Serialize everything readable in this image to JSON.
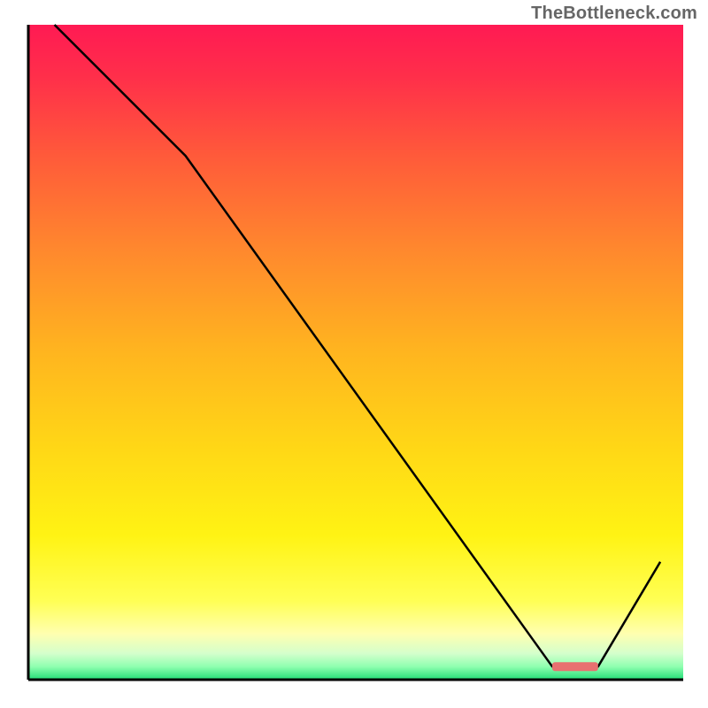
{
  "watermark": "TheBottleneck.com",
  "chart_data": {
    "type": "line",
    "x": [
      0.04,
      0.24,
      0.8,
      0.87,
      0.965
    ],
    "values": [
      1.0,
      0.8,
      0.02,
      0.02,
      0.18
    ],
    "title": "",
    "xlabel": "",
    "ylabel": "",
    "xlim": [
      0,
      1
    ],
    "ylim": [
      0,
      1
    ],
    "marker": {
      "x": [
        0.8,
        0.87
      ],
      "y": [
        0.02,
        0.02
      ],
      "label": ""
    },
    "background": "red-yellow-green-vertical-gradient",
    "axes_visible": true,
    "ticks_visible": false
  },
  "plot": {
    "inner_left": 32,
    "inner_top": 28,
    "inner_right": 772,
    "inner_bottom": 768
  }
}
